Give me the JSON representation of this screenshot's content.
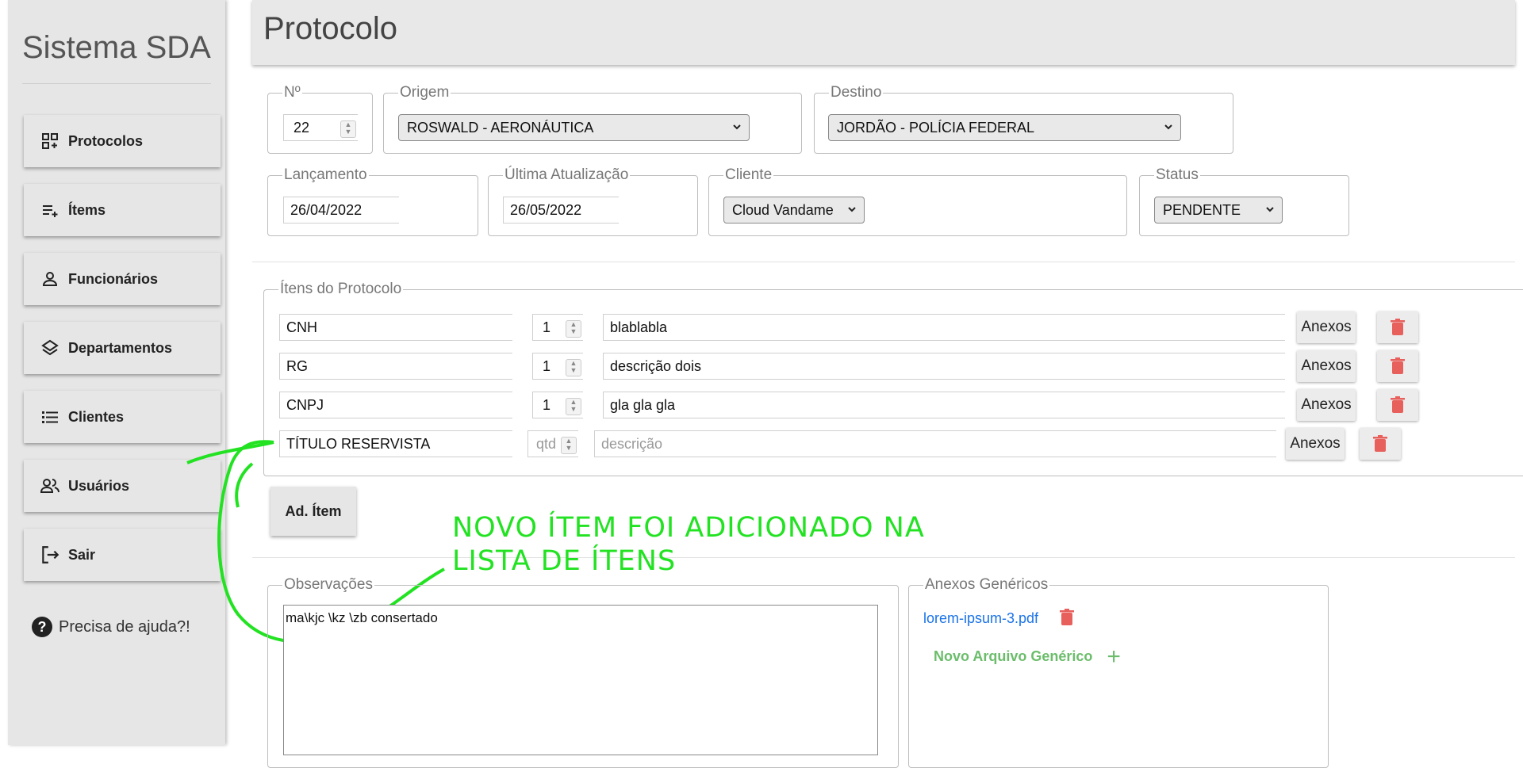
{
  "sidebar": {
    "brand": "Sistema SDA",
    "items": [
      {
        "label": "Protocolos",
        "icon": "grid-plus-icon"
      },
      {
        "label": "Ítems",
        "icon": "list-add-icon"
      },
      {
        "label": "Funcionários",
        "icon": "person-icon"
      },
      {
        "label": "Departamentos",
        "icon": "layers-icon"
      },
      {
        "label": "Clientes",
        "icon": "list-icon"
      },
      {
        "label": "Usuários",
        "icon": "people-icon"
      },
      {
        "label": "Sair",
        "icon": "logout-icon"
      }
    ],
    "help": "Precisa de ajuda?!"
  },
  "header": {
    "title": "Protocolo"
  },
  "form": {
    "numero": {
      "label": "Nº",
      "value": "22"
    },
    "origem": {
      "label": "Origem",
      "value": "ROSWALD - AERONÁUTICA"
    },
    "destino": {
      "label": "Destino",
      "value": "JORDÃO - POLÍCIA FEDERAL"
    },
    "lancamento": {
      "label": "Lançamento",
      "value": "26/04/2022"
    },
    "ultima": {
      "label": "Última Atualização",
      "value": "26/05/2022"
    },
    "cliente": {
      "label": "Cliente",
      "value": "Cloud Vandame"
    },
    "status": {
      "label": "Status",
      "value": "PENDENTE"
    }
  },
  "itens": {
    "legend": "Ítens do Protocolo",
    "anexos_label": "Anexos",
    "rows": [
      {
        "titulo": "CNH",
        "qtd": "1",
        "descricao": "blablabla"
      },
      {
        "titulo": "RG",
        "qtd": "1",
        "descricao": "descrição dois"
      },
      {
        "titulo": "CNPJ",
        "qtd": "1",
        "descricao": "gla gla gla"
      },
      {
        "titulo": "TÍTULO RESERVISTA",
        "qtd": "",
        "descricao": "",
        "qtd_placeholder": "qtd",
        "descricao_placeholder": "descrição"
      }
    ],
    "add_button": "Ad. Ítem"
  },
  "annotation": {
    "line1": "NOVO ÍTEM FOI ADICIONADO NA",
    "line2": "LISTA DE ÍTENS",
    "color": "#22e222"
  },
  "observacoes": {
    "label": "Observações",
    "value": "ma\\kjc \\kz \\zb  consertado"
  },
  "anexos_genericos": {
    "label": "Anexos Genéricos",
    "files": [
      "lorem-ipsum-3.pdf"
    ],
    "new_label": "Novo Arquivo Genérico"
  },
  "colors": {
    "trash": "#e8605c",
    "link": "#1a73e8",
    "green": "#6bbd6b"
  }
}
